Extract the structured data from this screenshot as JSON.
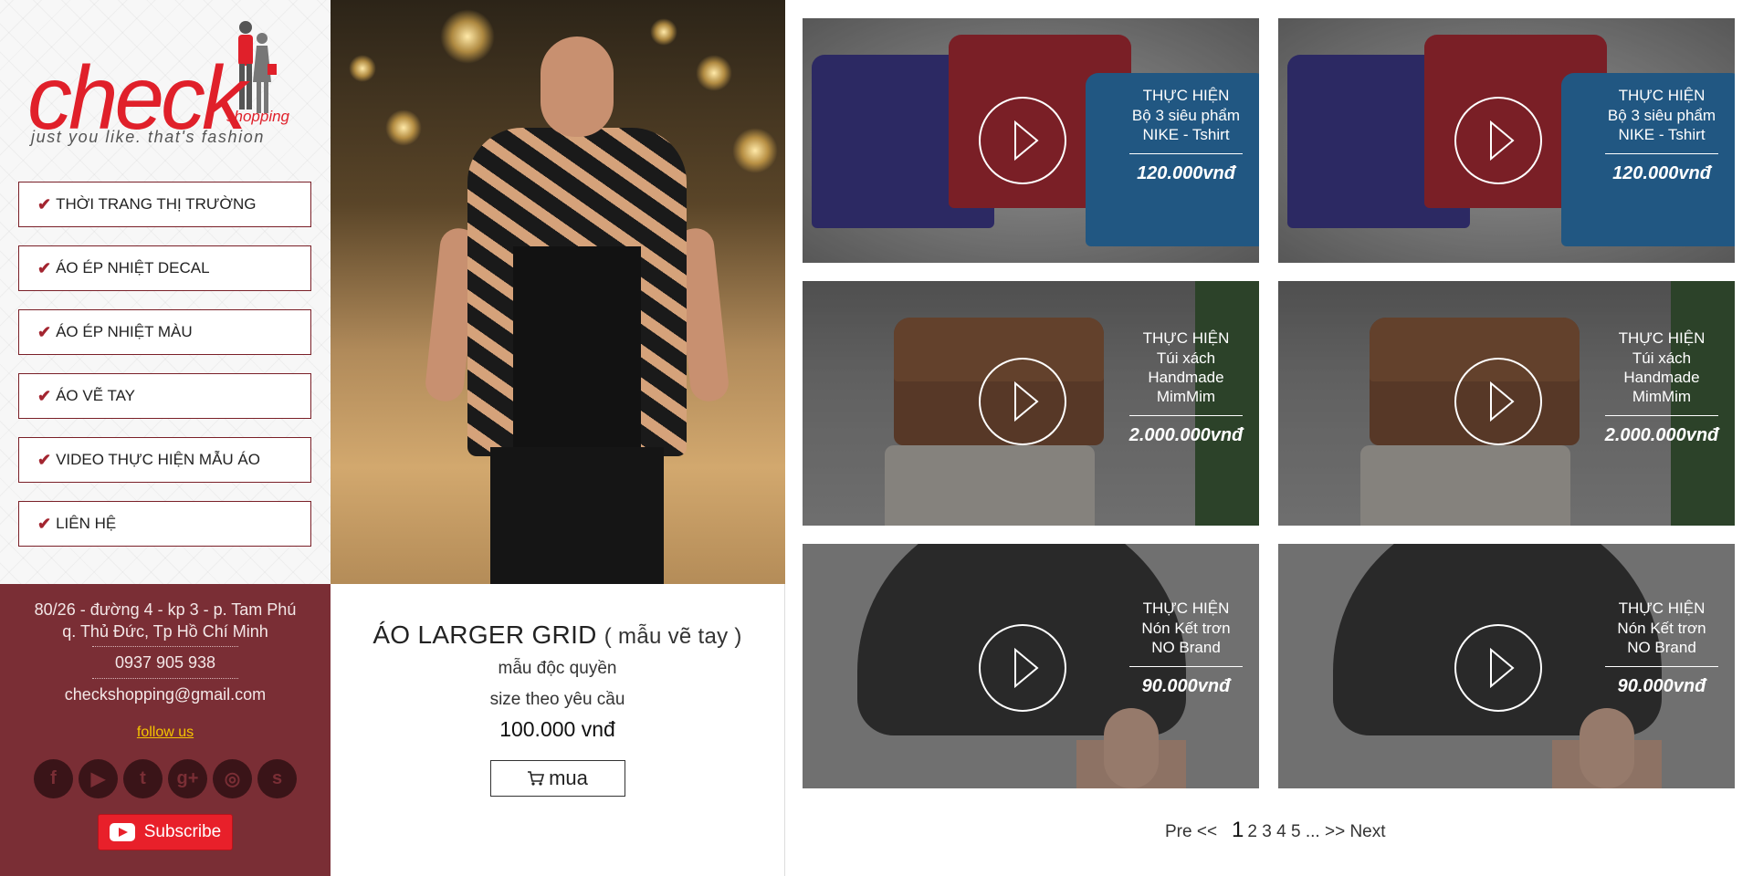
{
  "logo": {
    "word": "check",
    "word2": "shopping",
    "tagline": "just you like. that's fashion"
  },
  "menu": [
    {
      "label": "THỜI TRANG THỊ TRƯỜNG"
    },
    {
      "label": "ÁO ÉP NHIỆT DECAL"
    },
    {
      "label": "ÁO ÉP NHIỆT MÀU"
    },
    {
      "label": "ÁO VẼ TAY"
    },
    {
      "label": "VIDEO THỰC HIỆN MẪU ÁO"
    },
    {
      "label": "LIÊN HỆ"
    }
  ],
  "contact": {
    "address_line1": "80/26 - đường 4 - kp 3 - p. Tam Phú",
    "address_line2": "q. Thủ Đức, Tp Hồ Chí Minh",
    "phone": "0937 905 938",
    "email": "checkshopping@gmail.com",
    "follow": "follow us",
    "subscribe": "Subscribe",
    "socials": [
      "facebook-icon",
      "youtube-icon",
      "twitter-icon",
      "google-plus-icon",
      "instagram-icon",
      "skype-icon"
    ]
  },
  "featured": {
    "title": "ÁO LARGER GRID",
    "subtitle": "( mẫu vẽ tay )",
    "line1": "mẫu độc quyền",
    "line2": "size theo yêu cầu",
    "price": "100.000 vnđ",
    "buy_label": "mua"
  },
  "products": [
    {
      "heading": "THỰC HIỆN",
      "name1": "Bộ 3 siêu phẩm",
      "name2": "NIKE - Tshirt",
      "price": "120.000vnđ",
      "image": "shirts"
    },
    {
      "heading": "THỰC HIỆN",
      "name1": "Bộ 3 siêu phẩm",
      "name2": "NIKE - Tshirt",
      "price": "120.000vnđ",
      "image": "shirts"
    },
    {
      "heading": "THỰC HIỆN",
      "name1": "Túi xách Handmade",
      "name2": "MimMim",
      "price": "2.000.000vnđ",
      "image": "bag"
    },
    {
      "heading": "THỰC HIỆN",
      "name1": "Túi xách Handmade",
      "name2": "MimMim",
      "price": "2.000.000vnđ",
      "image": "bag"
    },
    {
      "heading": "THỰC HIỆN",
      "name1": "Nón Kết trơn",
      "name2": "NO Brand",
      "price": "90.000vnđ",
      "image": "cap"
    },
    {
      "heading": "THỰC HIỆN",
      "name1": "Nón Kết trơn",
      "name2": "NO Brand",
      "price": "90.000vnđ",
      "image": "cap"
    }
  ],
  "pagination": {
    "prev": "Pre <<",
    "current": "1",
    "pages": [
      "2",
      "3",
      "4",
      "5"
    ],
    "ellipsis": "...",
    "next": ">> Next"
  },
  "colors": {
    "brand_red": "#e0202a",
    "sidebar_maroon": "#7a2e35",
    "follow_yellow": "#f5c400"
  }
}
